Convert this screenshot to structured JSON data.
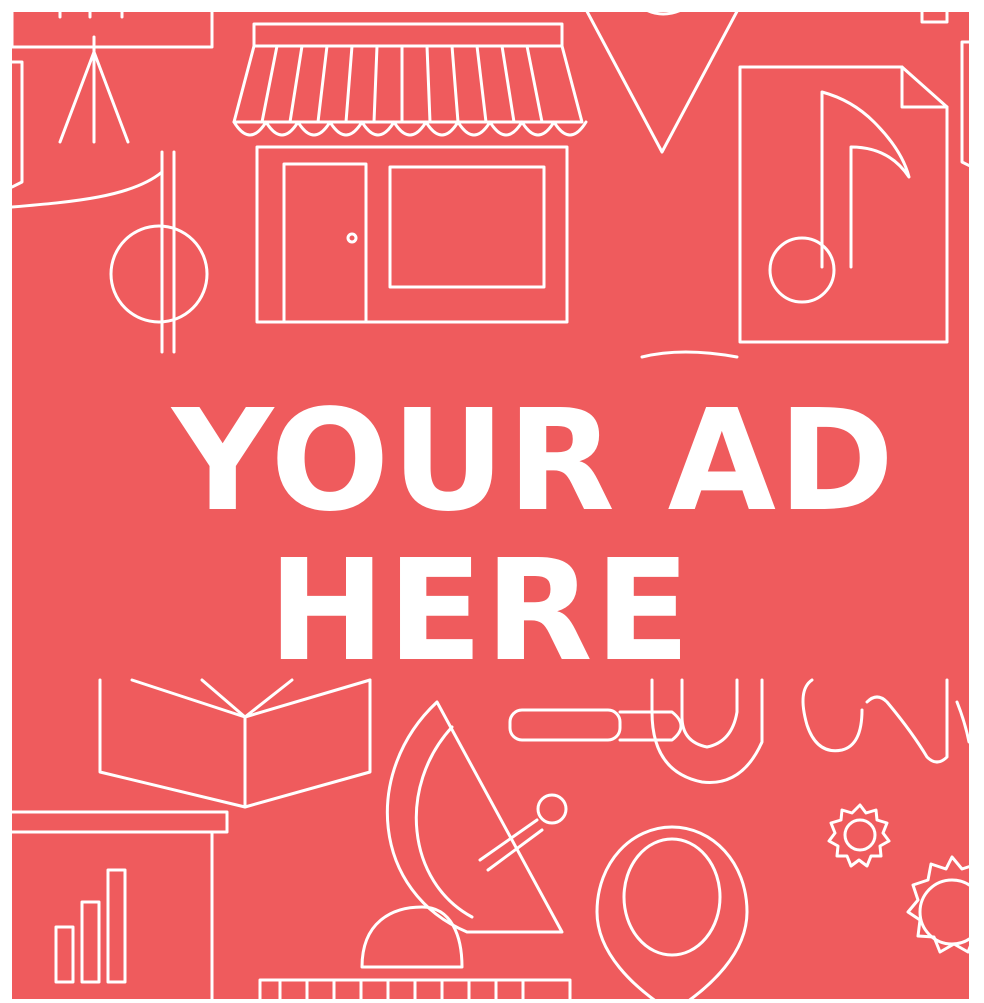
{
  "ad": {
    "headline_line1": "YOUR AD",
    "headline_line2": "HERE",
    "background_color": "#ef5b5d",
    "icons": [
      "presentation-stand-icon",
      "storefront-icon",
      "location-pin-icon",
      "music-file-icon",
      "flag-icon",
      "open-box-icon",
      "paper-clip-icon",
      "satellite-dish-icon",
      "gears-icon",
      "bar-chart-board-icon",
      "ribbon-icon"
    ]
  }
}
